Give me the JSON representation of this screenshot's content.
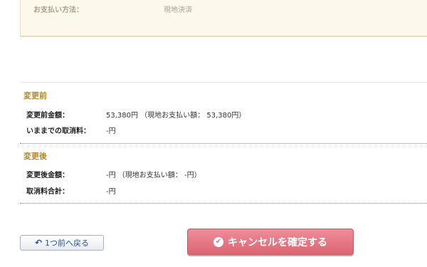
{
  "payment": {
    "label": "お支払い方法：",
    "value": "現地決済"
  },
  "before": {
    "title": "変更前",
    "amount_label": "変更前金額：",
    "amount_value": "53,380円 （現地お支払い額： 53,380円）",
    "fee_label": "いままでの取消料：",
    "fee_value": "-円"
  },
  "after": {
    "title": "変更後",
    "amount_label": "変更後金額：",
    "amount_value": "-円 （現地お支払い額： -円）",
    "fee_label": "取消料合計：",
    "fee_value": "-円"
  },
  "buttons": {
    "back_label": "1つ前へ戻る",
    "back_icon": "return-arrow-icon",
    "confirm_label": "キャンセルを確定する",
    "confirm_icon": "check-circle-icon"
  },
  "colors": {
    "section_title": "#b28a2c",
    "confirm_button": "#e57883",
    "back_text": "#2a5591",
    "payment_bg": "#fcf8ec"
  }
}
